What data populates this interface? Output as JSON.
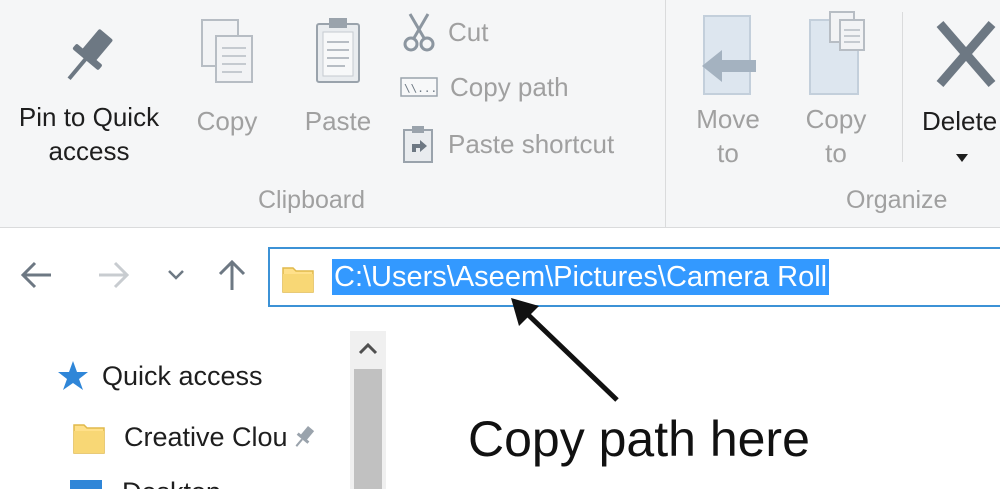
{
  "ribbon": {
    "pin": "Pin to Quick\naccess",
    "copy": "Copy",
    "paste": "Paste",
    "cut": "Cut",
    "copy_path": "Copy path",
    "paste_shortcut": "Paste shortcut",
    "clipboard_group": "Clipboard",
    "move_to": "Move\nto",
    "copy_to": "Copy\nto",
    "delete": "Delete",
    "organize_group": "Organize"
  },
  "address": {
    "path": "C:\\Users\\Aseem\\Pictures\\Camera Roll"
  },
  "nav_pane": {
    "items": [
      "Quick access",
      "Creative Clou",
      "Desktop"
    ]
  },
  "annotation": "Copy path here",
  "colors": {
    "accent": "#3399ff",
    "ribbon_bg": "#f5f6f7",
    "disabled_text": "#a0a0a0"
  }
}
